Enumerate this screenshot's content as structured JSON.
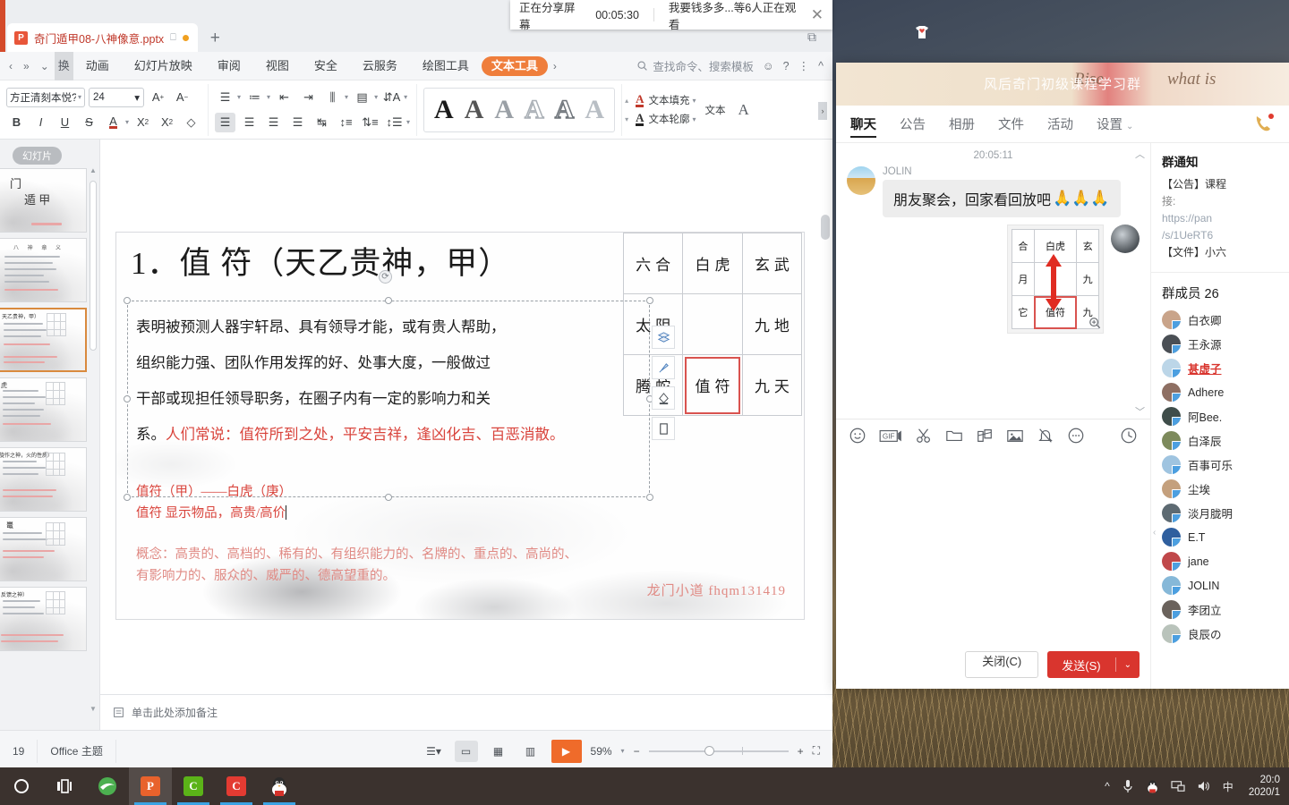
{
  "share_banner": {
    "status": "正在分享屏幕",
    "duration": "00:05:30",
    "viewers": "我要钱多多...等6人正在观看",
    "close": "✕"
  },
  "wps": {
    "doc_tab": {
      "title": "奇门遁甲08-八神像意.pptx",
      "monitor_icon": "monitor-icon"
    },
    "new_tab": "+",
    "ribbon_tabs": [
      {
        "label": "换",
        "state": "clipped"
      },
      {
        "label": "动画",
        "state": "normal"
      },
      {
        "label": "幻灯片放映",
        "state": "normal"
      },
      {
        "label": "审阅",
        "state": "normal"
      },
      {
        "label": "视图",
        "state": "normal"
      },
      {
        "label": "安全",
        "state": "normal"
      },
      {
        "label": "云服务",
        "state": "normal"
      },
      {
        "label": "绘图工具",
        "state": "normal"
      },
      {
        "label": "文本工具",
        "state": "active"
      }
    ],
    "search_placeholder": "查找命令、搜索模板",
    "font": {
      "name": "方正清刻本悦?",
      "size": "24"
    },
    "text_fill": "文本填充",
    "text_outline": "文本轮廓",
    "text_effect": "文本",
    "thumbs_label": "幻灯片",
    "notes_placeholder": "单击此处添加备注",
    "status": {
      "slide_num": "19",
      "theme": "Office 主题",
      "zoom": "59%"
    }
  },
  "slide": {
    "title": "1．值 符（天乙贵神，甲）",
    "paragraphs": [
      "表明被预测人器宇轩昂、具有领导才能，或有贵人帮助，",
      "组织能力强、团队作用发挥的好、处事大度，一般做过",
      "干部或现担任领导职务，在圈子内有一定的影响力和关"
    ],
    "last_line_black": "系。",
    "last_line_red": "人们常说：值符所到之处，平安吉祥，逢凶化吉、百恶消散。",
    "red_line1": "值符（甲）——白虎（庚）",
    "red_line2": "值符 显示物品，高贵/高价",
    "concept_line1": "概念：高贵的、高档的、稀有的、有组织能力的、名牌的、重点的、高尚的、",
    "concept_line2": "有影响力的、服众的、威严的、德高望重的。",
    "watermark": "龙门小道  fhqm131419",
    "grid": [
      [
        "六合",
        "白虎",
        "玄武"
      ],
      [
        "太阴",
        "",
        "九地"
      ],
      [
        "腾蛇",
        "值符",
        "九天"
      ]
    ]
  },
  "qq": {
    "window_title": "风后奇门初级课程学习群",
    "header_art_left": "Rise",
    "header_art_right": "what is",
    "tabs": [
      {
        "label": "聊天",
        "active": true
      },
      {
        "label": "公告",
        "active": false
      },
      {
        "label": "相册",
        "active": false
      },
      {
        "label": "文件",
        "active": false
      },
      {
        "label": "活动",
        "active": false
      },
      {
        "label": "设置",
        "active": false,
        "caret": "⌄"
      }
    ],
    "phone_icon": "phone-call-icon",
    "messages": {
      "timestamp": "20:05:11",
      "items": [
        {
          "sender": "JOLIN",
          "text": "朋友聚会，回家看回放吧",
          "emojis": "🙏🙏🙏",
          "side": "left"
        },
        {
          "sender": "",
          "type": "image",
          "side": "right"
        }
      ]
    },
    "image_card": {
      "grid": [
        [
          "合",
          "白虎",
          "玄"
        ],
        [
          "月",
          "",
          "九"
        ],
        [
          "它",
          "值符",
          "九"
        ]
      ],
      "zoom_icon": "zoom-in-icon"
    },
    "input_tools": [
      "smiley-icon",
      "gif-icon",
      "scissors-icon",
      "folder-icon",
      "screenshot-icon",
      "image-icon",
      "bell-off-icon",
      "more-icon"
    ],
    "history_icon": "history-clock-icon",
    "btn_close": "关闭(C)",
    "btn_send": "发送(S)",
    "btn_send_caret": "⌄",
    "notice": {
      "title": "群通知",
      "lines": [
        {
          "text": "【公告】课程",
          "style": "dark"
        },
        {
          "text": "接:",
          "style": "muted"
        },
        {
          "text": "https://pan",
          "style": "link"
        },
        {
          "text": "/s/1UeRT6",
          "style": "link"
        },
        {
          "text": "【文件】小六",
          "style": "dark"
        }
      ]
    },
    "members_header": "群成员 26",
    "members": [
      {
        "name": "白衣卿",
        "highlight": false,
        "color": "#c9a48a"
      },
      {
        "name": "王永源",
        "highlight": false,
        "color": "#4a4f55"
      },
      {
        "name": "甚虚子",
        "highlight": true,
        "color": "#bcd6e8"
      },
      {
        "name": "Adhere",
        "highlight": false,
        "color": "#8e6f63"
      },
      {
        "name": "阿Bee.",
        "highlight": false,
        "color": "#3f4d4a"
      },
      {
        "name": "白泽辰",
        "highlight": false,
        "color": "#7d8a5c"
      },
      {
        "name": "百事可乐",
        "highlight": false,
        "color": "#9fc4e0"
      },
      {
        "name": "尘埃",
        "highlight": false,
        "color": "#c4a07d"
      },
      {
        "name": "淡月胧明",
        "highlight": false,
        "color": "#5d6a72"
      },
      {
        "name": "E.T",
        "highlight": false,
        "color": "#2f5f9e"
      },
      {
        "name": "jane",
        "highlight": false,
        "color": "#c0484a"
      },
      {
        "name": "JOLIN",
        "highlight": false,
        "color": "#86b8d8"
      },
      {
        "name": "李团立",
        "highlight": false,
        "color": "#6a625c"
      },
      {
        "name": "良辰の",
        "highlight": false,
        "color": "#b9c3bb"
      }
    ]
  },
  "taskbar": {
    "items": [
      {
        "name": "cortana-circle-icon",
        "label": "○"
      },
      {
        "name": "task-view-icon",
        "label": "▤"
      },
      {
        "name": "browser-icon",
        "label": "e"
      },
      {
        "name": "wps-presentation-icon",
        "label": "P"
      },
      {
        "name": "wechat-green-icon",
        "label": "C"
      },
      {
        "name": "app-red-icon",
        "label": "C"
      },
      {
        "name": "qq-penguin-icon",
        "label": "🐧"
      }
    ],
    "tray": [
      "^",
      "microphone-icon",
      "qq-penguin-icon",
      "network-icon",
      "volume-icon",
      "中"
    ],
    "clock_time": "20:0",
    "clock_date": "2020/1"
  },
  "colors": {
    "accent_orange": "#ef7e3c",
    "send_red": "#d9352e",
    "slide_red": "#d9443c",
    "taskbar": "#3b322e"
  }
}
